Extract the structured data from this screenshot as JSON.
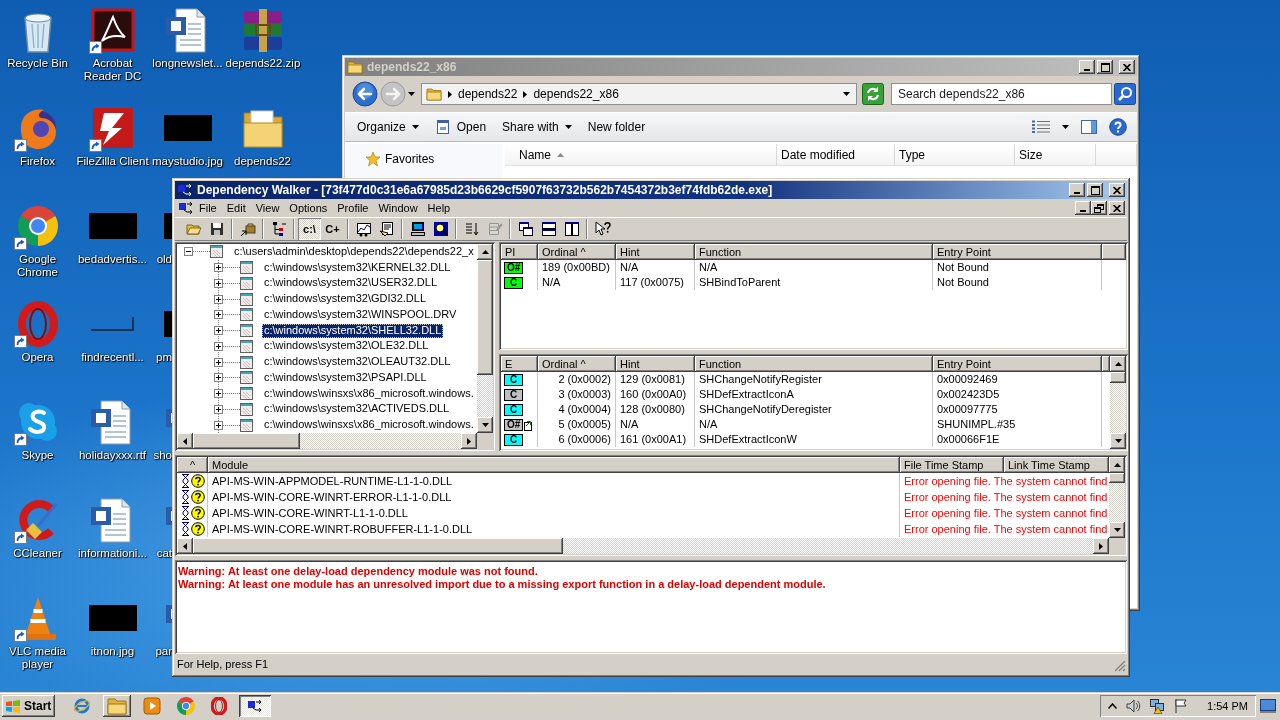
{
  "desktop": {
    "icons": [
      {
        "label": "Recycle Bin",
        "kind": "bin",
        "shortcut": false,
        "cut": false
      },
      {
        "label": "Firefox",
        "kind": "fox",
        "shortcut": true,
        "cut": false
      },
      {
        "label": "Google Chrome",
        "kind": "chrome",
        "shortcut": true,
        "cut": false
      },
      {
        "label": "Opera",
        "kind": "opera",
        "shortcut": true,
        "cut": false
      },
      {
        "label": "Skype",
        "kind": "skype",
        "shortcut": true,
        "cut": false
      },
      {
        "label": "CCleaner",
        "kind": "cleaner",
        "shortcut": true,
        "cut": false
      },
      {
        "label": "VLC media player",
        "kind": "cone",
        "shortcut": true,
        "cut": false
      },
      {
        "label": "Acrobat Reader DC",
        "kind": "reader",
        "shortcut": true,
        "cut": false
      },
      {
        "label": "FileZilla Client",
        "kind": "ftp",
        "shortcut": true,
        "cut": false
      },
      {
        "label": "bedadvertis...",
        "kind": "photo",
        "shortcut": false,
        "cut": false
      },
      {
        "label": "findrecentl...",
        "kind": "sketch",
        "shortcut": false,
        "cut": false
      },
      {
        "label": "holidayxxx.rtf",
        "kind": "doc",
        "shortcut": false,
        "cut": false
      },
      {
        "label": "informationi...",
        "kind": "doc",
        "shortcut": false,
        "cut": false
      },
      {
        "label": "itnon.jpg",
        "kind": "photo",
        "shortcut": false,
        "cut": false
      },
      {
        "label": "longnewslet...",
        "kind": "doc",
        "shortcut": false,
        "cut": false
      },
      {
        "label": "maystudio.jpg",
        "kind": "photo",
        "shortcut": false,
        "cut": false
      },
      {
        "label": "old",
        "kind": "photo",
        "shortcut": false,
        "cut": true
      },
      {
        "label": "pm",
        "kind": "photo",
        "shortcut": false,
        "cut": true
      },
      {
        "label": "sho",
        "kind": "doc",
        "shortcut": false,
        "cut": true
      },
      {
        "label": "cat",
        "kind": "doc",
        "shortcut": false,
        "cut": true
      },
      {
        "label": "par",
        "kind": "doc",
        "shortcut": false,
        "cut": true
      },
      {
        "label": "depends22.zip",
        "kind": "archive",
        "shortcut": false,
        "cut": false
      },
      {
        "label": "depends22",
        "kind": "folder",
        "shortcut": false,
        "cut": false
      }
    ]
  },
  "explorer": {
    "title": "depends22_x86",
    "active": false,
    "path": [
      "depends22",
      "depends22_x86"
    ],
    "search": {
      "placeholder": "Search depends22_x86"
    },
    "commands": [
      {
        "label": "Organize",
        "kind": "menu"
      },
      {
        "label": "Open",
        "kind": "icon"
      },
      {
        "label": "Share with",
        "kind": "menu"
      },
      {
        "label": "New folder",
        "kind": "plain"
      }
    ],
    "nav": [
      {
        "label": "Favorites"
      }
    ],
    "columns": [
      {
        "label": "Name",
        "sorted": true
      },
      {
        "label": "Date modified",
        "sorted": false
      },
      {
        "label": "Type",
        "sorted": false
      },
      {
        "label": "Size",
        "sorted": false
      }
    ]
  },
  "dependency_walker": {
    "title": "Dependency Walker - [73f477d0c31e6a67985d23b6629cf5907f63732b562b7454372b3ef74fdb62de.exe]",
    "active": true,
    "menu": [
      "File",
      "Edit",
      "View",
      "Options",
      "Profile",
      "Window",
      "Help"
    ],
    "toolbar": [
      [
        {
          "kind": "open",
          "pressed": false,
          "disabled": false
        },
        {
          "kind": "save",
          "pressed": false,
          "disabled": false
        }
      ],
      [
        {
          "kind": "find",
          "pressed": false,
          "disabled": false
        }
      ],
      [
        {
          "kind": "tree",
          "pressed": false,
          "disabled": false
        }
      ],
      [
        {
          "kind": "text",
          "label": "c:\\",
          "pressed": true,
          "disabled": false
        },
        {
          "kind": "text",
          "label": "C+",
          "pressed": false,
          "disabled": false
        }
      ],
      [
        {
          "kind": "chart",
          "pressed": false,
          "disabled": false
        },
        {
          "kind": "properties",
          "pressed": false,
          "disabled": false
        }
      ],
      [
        {
          "kind": "computer",
          "pressed": false,
          "disabled": false
        },
        {
          "kind": "zoom",
          "pressed": false,
          "disabled": false
        }
      ],
      [
        {
          "kind": "sort",
          "pressed": false,
          "disabled": false
        },
        {
          "kind": "list",
          "pressed": false,
          "disabled": true
        }
      ],
      [
        {
          "kind": "cascade",
          "pressed": false,
          "disabled": false
        },
        {
          "kind": "tile-h",
          "pressed": false,
          "disabled": false
        },
        {
          "kind": "tile-v",
          "pressed": false,
          "disabled": false
        }
      ],
      [
        {
          "kind": "help",
          "pressed": false,
          "disabled": false
        }
      ]
    ],
    "tree": [
      {
        "label": "c:\\users\\admin\\desktop\\depends22\\depends22_x",
        "expanded": true,
        "selected": false,
        "children": [
          {
            "label": "c:\\windows\\system32\\KERNEL32.DLL",
            "expanded": false,
            "selected": false
          },
          {
            "label": "c:\\windows\\system32\\USER32.DLL",
            "expanded": false,
            "selected": false
          },
          {
            "label": "c:\\windows\\system32\\GDI32.DLL",
            "expanded": false,
            "selected": false
          },
          {
            "label": "c:\\windows\\system32\\WINSPOOL.DRV",
            "expanded": false,
            "selected": false
          },
          {
            "label": "c:\\windows\\system32\\SHELL32.DLL",
            "expanded": false,
            "selected": true
          },
          {
            "label": "c:\\windows\\system32\\OLE32.DLL",
            "expanded": false,
            "selected": false
          },
          {
            "label": "c:\\windows\\system32\\OLEAUT32.DLL",
            "expanded": false,
            "selected": false
          },
          {
            "label": "c:\\windows\\system32\\PSAPI.DLL",
            "expanded": false,
            "selected": false
          },
          {
            "label": "c:\\windows\\winsxs\\x86_microsoft.windows.",
            "expanded": false,
            "selected": false
          },
          {
            "label": "c:\\windows\\system32\\ACTIVEDS.DLL",
            "expanded": false,
            "selected": false
          },
          {
            "label": "c:\\windows\\winsxs\\x86_microsoft.windows.",
            "expanded": false,
            "selected": false
          }
        ]
      }
    ],
    "imports": {
      "columns": [
        "PI",
        "Ordinal ^",
        "Hint",
        "Function",
        "Entry Point"
      ],
      "rows": [
        {
          "tag": "O#",
          "color": "#00ff00",
          "forwarded": false,
          "ordinal": "189 (0x00BD)",
          "hint": "N/A",
          "function": "N/A",
          "entry_point": "Not Bound"
        },
        {
          "tag": "C",
          "color": "#00ff00",
          "forwarded": false,
          "ordinal": "N/A",
          "hint": "117 (0x0075)",
          "function": "SHBindToParent",
          "entry_point": "Not Bound"
        }
      ]
    },
    "exports": {
      "columns": [
        "E",
        "Ordinal ^",
        "Hint",
        "Function",
        "Entry Point"
      ],
      "rows": [
        {
          "tag": "C",
          "color": "#00ffff",
          "forwarded": false,
          "ordinal": "2 (0x0002)",
          "hint": "129 (0x0081)",
          "function": "SHChangeNotifyRegister",
          "entry_point": "0x00092469"
        },
        {
          "tag": "C",
          "color": "#c0c0c0",
          "forwarded": false,
          "ordinal": "3 (0x0003)",
          "hint": "160 (0x00A0)",
          "function": "SHDefExtractIconA",
          "entry_point": "0x002423D5"
        },
        {
          "tag": "C",
          "color": "#00ffff",
          "forwarded": false,
          "ordinal": "4 (0x0004)",
          "hint": "128 (0x0080)",
          "function": "SHChangeNotifyDeregister",
          "entry_point": "0x00097775"
        },
        {
          "tag": "O#",
          "color": "#c0c0c0",
          "forwarded": true,
          "ordinal": "5 (0x0005)",
          "hint": "N/A",
          "function": "N/A",
          "entry_point": "SHUNIMPL.#35"
        },
        {
          "tag": "C",
          "color": "#00ffff",
          "forwarded": false,
          "ordinal": "6 (0x0006)",
          "hint": "161 (0x00A1)",
          "function": "SHDefExtractIconW",
          "entry_point": "0x00066F1E"
        }
      ]
    },
    "modules": {
      "columns": [
        "^",
        "Module",
        "File Time Stamp",
        "Link Time Stamp"
      ],
      "rows": [
        {
          "delay_load": true,
          "found": false,
          "module": "API-MS-WIN-APPMODEL-RUNTIME-L1-1-0.DLL",
          "file_time_stamp": "Error opening file. The system cannot find",
          "error": true
        },
        {
          "delay_load": true,
          "found": false,
          "module": "API-MS-WIN-CORE-WINRT-ERROR-L1-1-0.DLL",
          "file_time_stamp": "Error opening file. The system cannot find",
          "error": true
        },
        {
          "delay_load": true,
          "found": false,
          "module": "API-MS-WIN-CORE-WINRT-L1-1-0.DLL",
          "file_time_stamp": "Error opening file. The system cannot find",
          "error": true
        },
        {
          "delay_load": true,
          "found": false,
          "module": "API-MS-WIN-CORE-WINRT-ROBUFFER-L1-1-0.DLL",
          "file_time_stamp": "Error opening file. The system cannot find",
          "error": true
        }
      ]
    },
    "log": [
      {
        "kind": "warning",
        "text": "Warning: At least one delay-load dependency module was not found."
      },
      {
        "kind": "warning",
        "text": "Warning: At least one module has an unresolved import due to a missing export function in a delay-load dependent module."
      }
    ],
    "status_bar": "For Help, press F1"
  },
  "taskbar": {
    "start": "Start",
    "apps": [
      {
        "kind": "ie",
        "running": false,
        "active": false
      },
      {
        "kind": "folder",
        "running": true,
        "active": false
      },
      {
        "kind": "media",
        "running": false,
        "active": false
      },
      {
        "kind": "chrome",
        "running": false,
        "active": false
      },
      {
        "kind": "opera",
        "running": false,
        "active": false
      },
      {
        "kind": "depends",
        "running": true,
        "active": true
      }
    ],
    "clock": "1:54 PM"
  }
}
